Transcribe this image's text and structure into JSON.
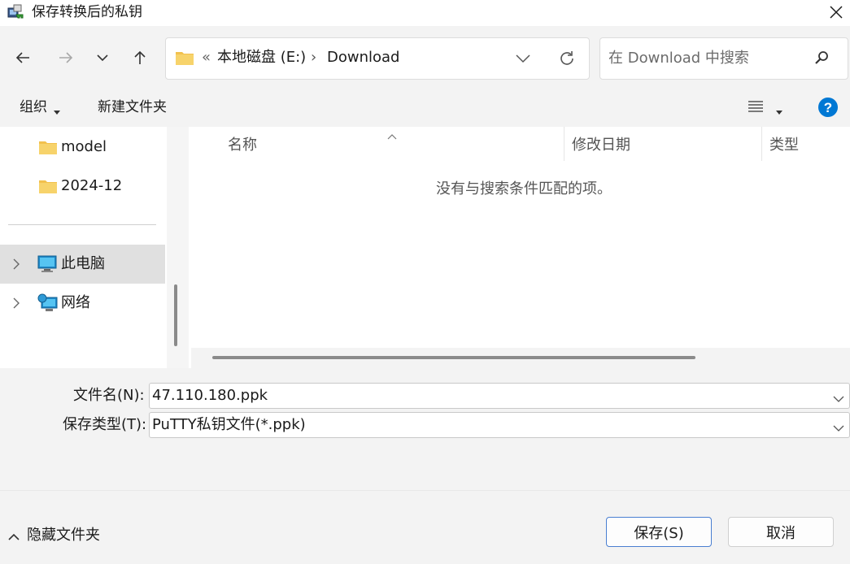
{
  "window": {
    "title": "保存转换后的私钥"
  },
  "address": {
    "overflow": "«",
    "segments": [
      "本地磁盘 (E:)",
      "Download"
    ],
    "separator": "›"
  },
  "search": {
    "placeholder": "在 Download 中搜索"
  },
  "commands": {
    "organize": "组织",
    "new_folder": "新建文件夹"
  },
  "navpane": {
    "items": [
      {
        "label": "model",
        "icon": "folder-icon"
      },
      {
        "label": "2024-12",
        "icon": "folder-icon"
      },
      {
        "label": "此电脑",
        "icon": "computer-icon",
        "selected": true
      },
      {
        "label": "网络",
        "icon": "network-icon"
      }
    ]
  },
  "columns": {
    "name": "名称",
    "modified": "修改日期",
    "type": "类型"
  },
  "content": {
    "empty_message": "没有与搜索条件匹配的项。"
  },
  "form": {
    "filename_label": "文件名(N):",
    "filename_value": "47.110.180.ppk",
    "filetype_label": "保存类型(T):",
    "filetype_value": "PuTTY私钥文件(*.ppk)"
  },
  "footer": {
    "hide_folders": "隐藏文件夹",
    "save": "保存(S)",
    "cancel": "取消"
  },
  "colors": {
    "accent": "#0078d4",
    "folder": "#f2c14e",
    "selection": "#e0e0e0"
  }
}
